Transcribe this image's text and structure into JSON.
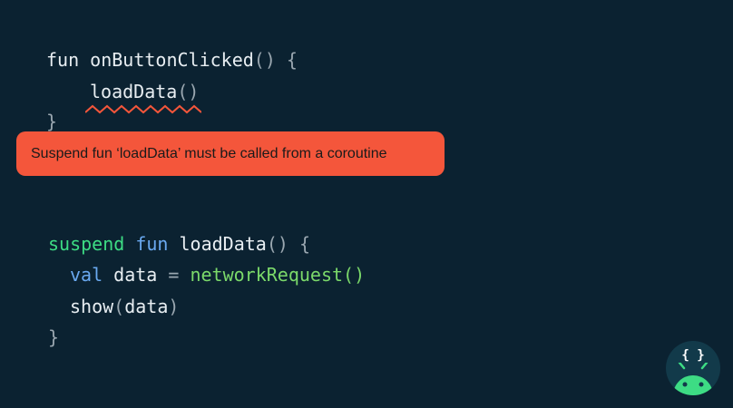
{
  "snippet1": {
    "line1": {
      "fun": "fun ",
      "name": "onButtonClicked",
      "parens": "()",
      "brace": " {"
    },
    "line2": {
      "call": "loadData",
      "parens": "()"
    },
    "line3": {
      "brace": "}"
    }
  },
  "error": {
    "message": "Suspend fun ‘loadData’ must be called from a coroutine",
    "color": "#f4563b"
  },
  "snippet2": {
    "line1": {
      "suspend": "suspend",
      "fun": " fun ",
      "name": "loadData",
      "parens": "()",
      "brace": " {"
    },
    "line2": {
      "val": "val",
      "name": " data ",
      "eq": "=",
      "call": " networkRequest",
      "parens": "()"
    },
    "line3": {
      "fn": "show",
      "open": "(",
      "arg": "data",
      "close": ")"
    },
    "line4": {
      "brace": "}"
    }
  },
  "badge": {
    "braces": "{ }",
    "icon": "android-icon",
    "color": "#3ddc84"
  },
  "colors": {
    "background": "#0b2231",
    "keyword_suspend": "#3ddc84",
    "keyword_blue": "#6aa9f0",
    "function_call": "#7bd96a"
  }
}
